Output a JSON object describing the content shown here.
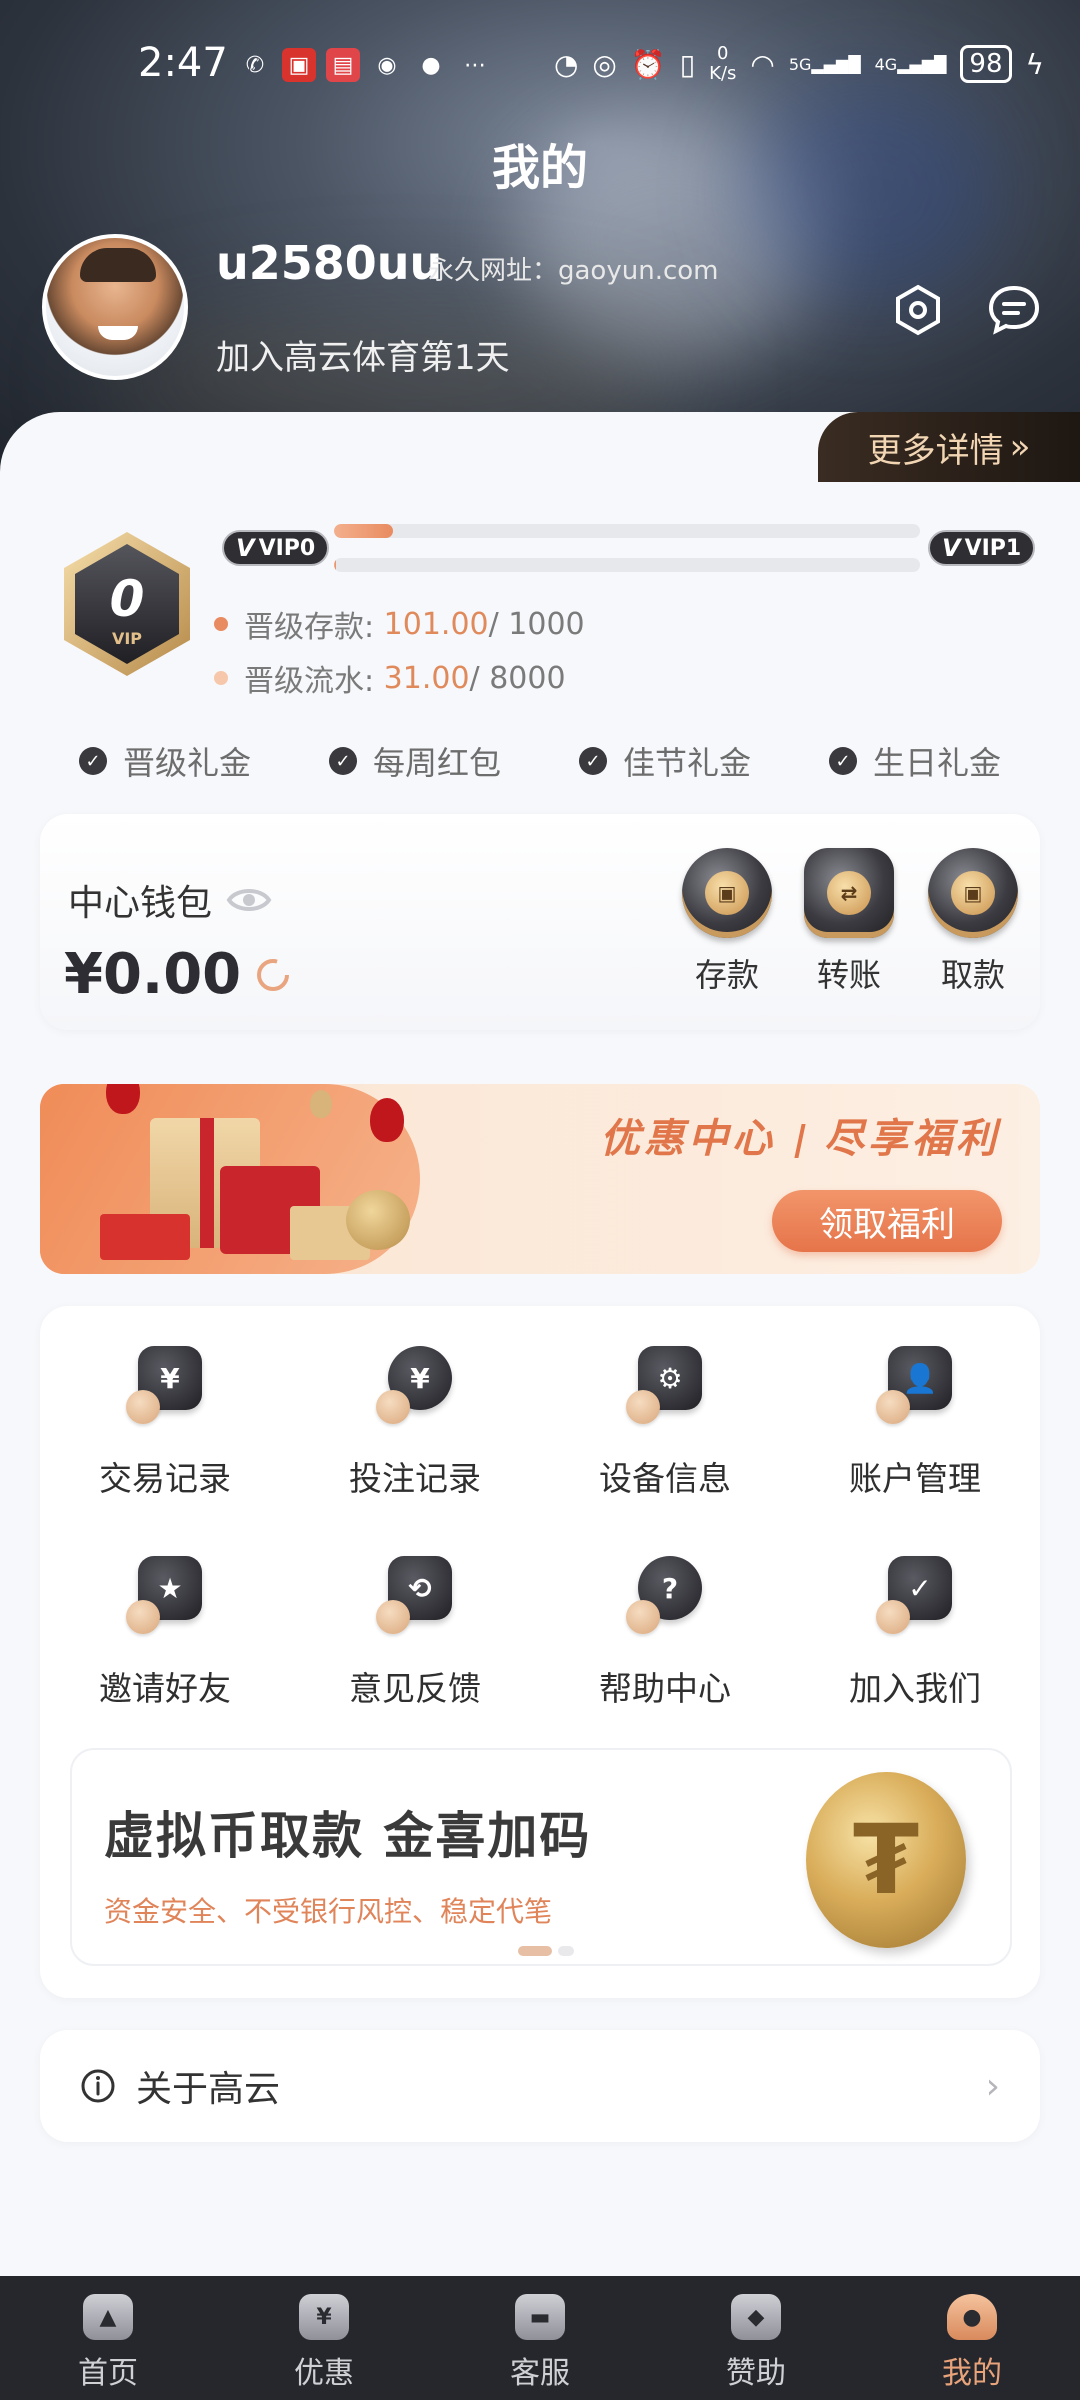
{
  "status_bar": {
    "time": "2:47",
    "net_speed_value": "0",
    "net_speed_unit": "K/s",
    "net_5g": "5G",
    "net_4g": "4G",
    "battery": "98"
  },
  "header": {
    "title": "我的",
    "username": "u2580uu",
    "url_label": "永久网址：gaoyun.com",
    "join_days": "加入高云体育第1天",
    "more_details": "更多详情"
  },
  "vip": {
    "badge_level": "0",
    "badge_text": "VIP",
    "current_level": "VIP0",
    "next_level": "VIP1",
    "deposit_label": "晋级存款:",
    "deposit_current": "101.00",
    "deposit_target": " / 1000",
    "deposit_progress": 0.1,
    "turnover_label": "晋级流水:",
    "turnover_current": "31.00",
    "turnover_target": " / 8000",
    "turnover_progress": 0.004,
    "accent_color": "#E08A5C"
  },
  "perks": [
    "晋级礼金",
    "每周红包",
    "佳节礼金",
    "生日礼金"
  ],
  "wallet": {
    "label": "中心钱包",
    "amount": "¥0.00",
    "actions": [
      {
        "label": "存款",
        "icon": "deposit-coin-icon"
      },
      {
        "label": "转账",
        "icon": "transfer-coin-icon"
      },
      {
        "label": "取款",
        "icon": "withdraw-coin-icon"
      }
    ]
  },
  "banner": {
    "title_left": "优惠中心",
    "title_right": "尽享福利",
    "button": "领取福利"
  },
  "menu": {
    "items": [
      {
        "label": "交易记录",
        "icon": "transaction-record-icon",
        "glyph": "¥"
      },
      {
        "label": "投注记录",
        "icon": "bet-record-icon",
        "glyph": "¥"
      },
      {
        "label": "设备信息",
        "icon": "device-info-icon",
        "glyph": "⚙"
      },
      {
        "label": "账户管理",
        "icon": "account-manage-icon",
        "glyph": "👤"
      },
      {
        "label": "邀请好友",
        "icon": "invite-friend-icon",
        "glyph": "★"
      },
      {
        "label": "意见反馈",
        "icon": "feedback-icon",
        "glyph": "⟲"
      },
      {
        "label": "帮助中心",
        "icon": "help-center-icon",
        "glyph": "?"
      },
      {
        "label": "加入我们",
        "icon": "join-us-icon",
        "glyph": "✓"
      }
    ]
  },
  "crypto_promo": {
    "title": "虚拟币取款  金喜加码",
    "subtitle": "资金安全、不受银行风控、稳定代笔"
  },
  "about": {
    "label": "关于高云"
  },
  "bottom_nav": {
    "active_index": 4,
    "items": [
      {
        "label": "首页",
        "icon": "home-icon"
      },
      {
        "label": "优惠",
        "icon": "promo-icon"
      },
      {
        "label": "客服",
        "icon": "service-icon"
      },
      {
        "label": "赞助",
        "icon": "sponsor-icon"
      },
      {
        "label": "我的",
        "icon": "profile-icon"
      }
    ]
  }
}
